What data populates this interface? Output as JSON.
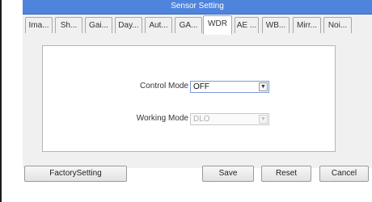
{
  "window": {
    "title": "Sensor Setting"
  },
  "tabs": [
    {
      "label": "Ima..."
    },
    {
      "label": "Sh..."
    },
    {
      "label": "Gai..."
    },
    {
      "label": "Day..."
    },
    {
      "label": "Aut..."
    },
    {
      "label": "GA..."
    },
    {
      "label": "WDR"
    },
    {
      "label": "AE ..."
    },
    {
      "label": "WB..."
    },
    {
      "label": "Mirr..."
    },
    {
      "label": "Noi..."
    }
  ],
  "active_tab": "WDR",
  "form": {
    "control_mode": {
      "label": "Control Mode",
      "value": "OFF"
    },
    "working_mode": {
      "label": "Working Mode",
      "value": "DLO"
    }
  },
  "buttons": {
    "factory": "FactorySetting",
    "save": "Save",
    "reset": "Reset",
    "cancel": "Cancel"
  },
  "colors": {
    "titlebar": "#4f84dd",
    "accent_border": "#7a9ad6"
  }
}
